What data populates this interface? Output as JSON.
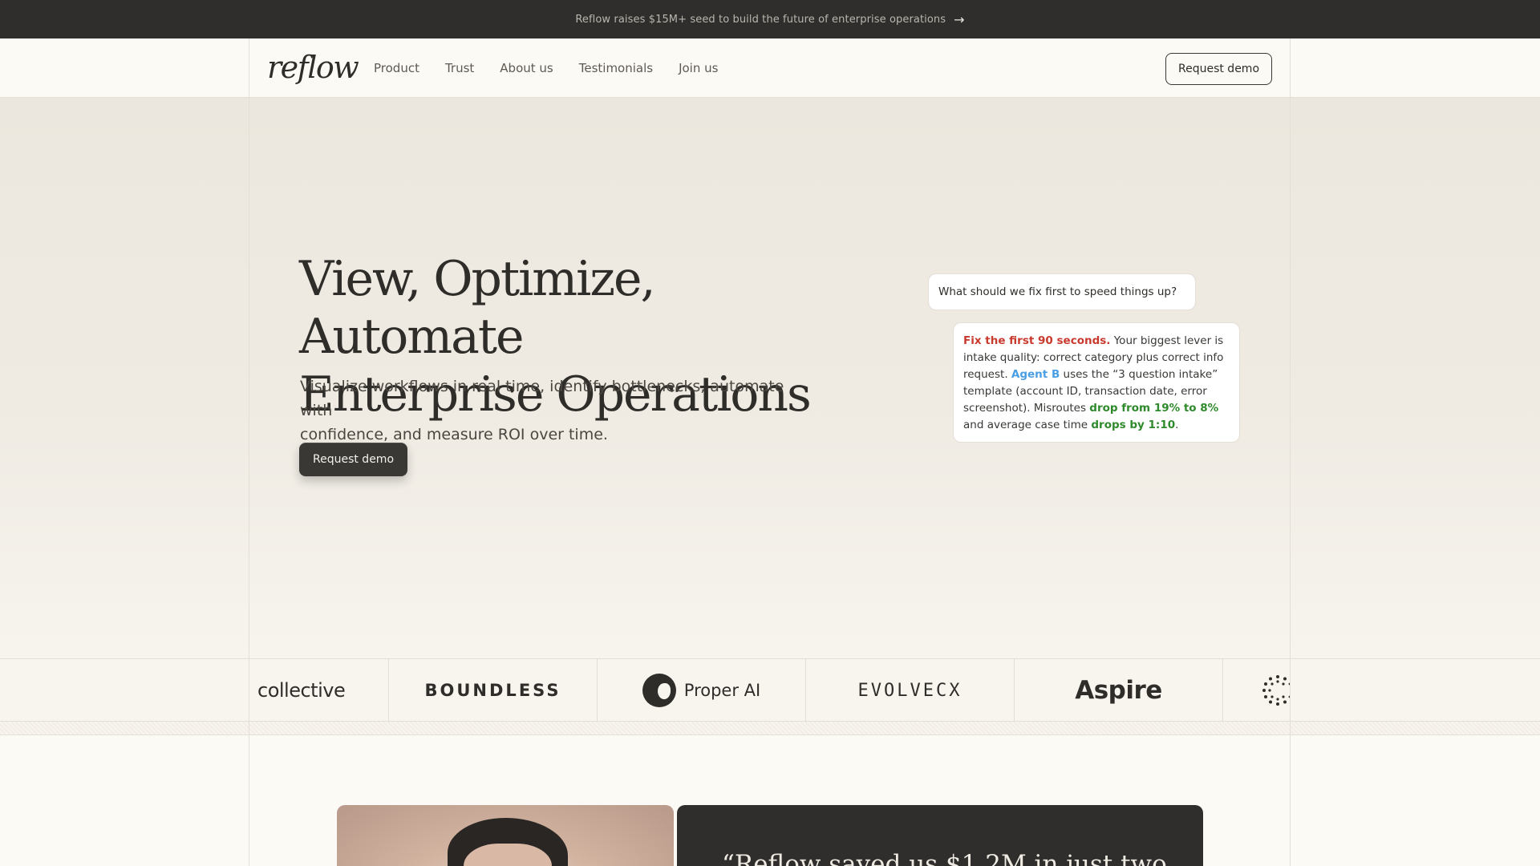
{
  "announcement": {
    "text": "Reflow raises $15M+ seed to build the future of enterprise operations",
    "arrow_icon": "arrow-right-icon"
  },
  "header": {
    "logo": "reflow",
    "nav": [
      "Product",
      "Trust",
      "About us",
      "Testimonials",
      "Join us"
    ],
    "cta": "Request demo"
  },
  "hero": {
    "title_line1": "View, Optimize, Automate",
    "title_line2": "Enterprise Operations",
    "subtitle_line1": "Visualize workflows in real time, identify bottlenecks, automate with",
    "subtitle_line2": "confidence, and measure ROI over time.",
    "cta": "Request demo"
  },
  "chat": {
    "question": "What should we fix first to speed things up?",
    "answer": {
      "lead": "Fix the first 90 seconds.",
      "part1": " Your biggest lever is intake quality: correct category plus correct info request. ",
      "agent": "Agent B",
      "part2": " uses the “3 question intake” template (account ID, transaction date, error screenshot). Misroutes ",
      "metric1": "drop from 19% to 8%",
      "part3": " and average case time ",
      "metric2": "drops by 1:10",
      "part4": "."
    }
  },
  "logos": [
    "collective",
    "BOUNDLESS",
    "Proper AI",
    "EVOLVECX",
    "Aspire"
  ],
  "testimonial": {
    "quote_start": "“Reflow saved us $1.2M in just two"
  },
  "colors": {
    "accent_dark": "#2f2e2c",
    "background": "#fcfaf5",
    "highlight_red": "#c93a2e",
    "highlight_blue": "#4a9ee3",
    "highlight_green": "#2f8a2c"
  }
}
